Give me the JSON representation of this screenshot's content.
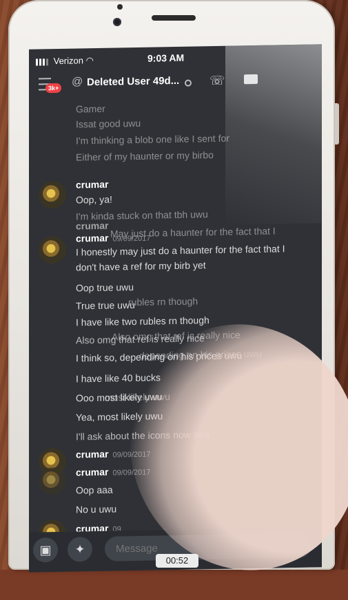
{
  "status_bar": {
    "carrier": "Verizon",
    "time": "9:03 AM"
  },
  "header": {
    "badge": "3k+",
    "channel": "Deleted User 49d..."
  },
  "messages_faint_top": [
    "Gamer",
    "Issat good uwu",
    "I'm thinking a blob one like I sent for ",
    "Either of my haunter or my birbo"
  ],
  "group1": {
    "author": "crumar",
    "lines": [
      "Oop, ya!",
      "I'm kinda stuck on that tbh uwu"
    ]
  },
  "group2": {
    "author": "crumar",
    "timestamp": "09/09/2017",
    "ghost_line": "May just do a haunter for the fact that I",
    "lines": [
      "I honestly may just do a haunter for the fact that I",
      "don't have a ref for my birb yet",
      "Oop true uwu",
      "True true uwu",
      "I have like two rubles rn though",
      "Also omg that ref is really nice",
      "I think so, depending on his prices uwu",
      "I have like 40 bucks",
      "Ooo most likely uwu",
      "Yea, most likely uwu",
      "I'll ask about the icons now aaa"
    ],
    "ghost_lines": [
      "rubles rn though",
      "Also omg that ref is really nice",
      "depending on his prices uwu",
      "most likely uwu",
      "I'll ask about the icons now aaa"
    ]
  },
  "group3": {
    "author": "crumar",
    "timestamp": "09/09/2017",
    "lines": [
      "Oop aaa",
      "No u uwu"
    ]
  },
  "group4": {
    "author": "crumar",
    "timestamp": "09"
  },
  "composer": {
    "placeholder": "Message"
  },
  "video": {
    "elapsed": "00:52"
  }
}
